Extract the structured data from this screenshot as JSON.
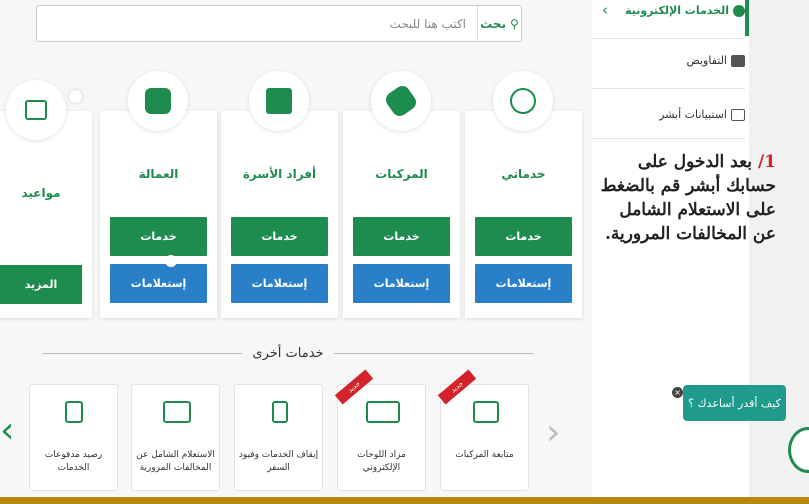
{
  "search": {
    "button_label": "بحث",
    "placeholder": "اكتب هنا للبحث"
  },
  "sidebar": {
    "header": "الخدمات الإلكترونية",
    "items": [
      {
        "label": "التفاويض"
      },
      {
        "label": "استبيانات أبشر"
      }
    ]
  },
  "instruction": {
    "number": "1/",
    "text": "بعد الدخول على حسابك أبشر قم بالضغط على الاستعلام الشامل عن المخالفات المرورية."
  },
  "cards": [
    {
      "title": "خدماتي",
      "services": "خدمات",
      "inquiries": "إستعلامات",
      "icon": "globe-icon"
    },
    {
      "title": "المركبات",
      "services": "خدمات",
      "inquiries": "إستعلامات",
      "icon": "car-icon"
    },
    {
      "title": "أفراد الأسرة",
      "services": "خدمات",
      "inquiries": "إستعلامات",
      "icon": "family-icon"
    },
    {
      "title": "العمالة",
      "services": "خدمات",
      "inquiries": "إستعلامات",
      "icon": "workers-icon"
    }
  ],
  "mawaeed": {
    "title": "مواعيد",
    "more": "المزيد",
    "icon": "calendar-icon"
  },
  "other_services": {
    "title": "خدمات أخرى",
    "tiles": [
      {
        "label": "متابعة المركبات",
        "badge": "جديد",
        "icon": "vehicles-icon"
      },
      {
        "label": "مزاد اللوحات الإلكتروني",
        "badge": "جديد",
        "icon": "plates-icon"
      },
      {
        "label": "إيقاف الخدمات وقيود السفر",
        "badge": "",
        "icon": "stop-icon"
      },
      {
        "label": "الاستعلام الشامل عن المخالفات المرورية",
        "badge": "",
        "icon": "id-card-icon"
      },
      {
        "label": "رصيد مدفوعات الخدمات",
        "badge": "",
        "icon": "receipt-icon"
      }
    ]
  },
  "help": {
    "label": "كيف أقدر أساعدك ؟",
    "close": "×"
  },
  "colors": {
    "green": "#1e8c4e",
    "blue": "#2a7fc9",
    "red": "#d2232a",
    "teal": "#1e9b8a"
  }
}
